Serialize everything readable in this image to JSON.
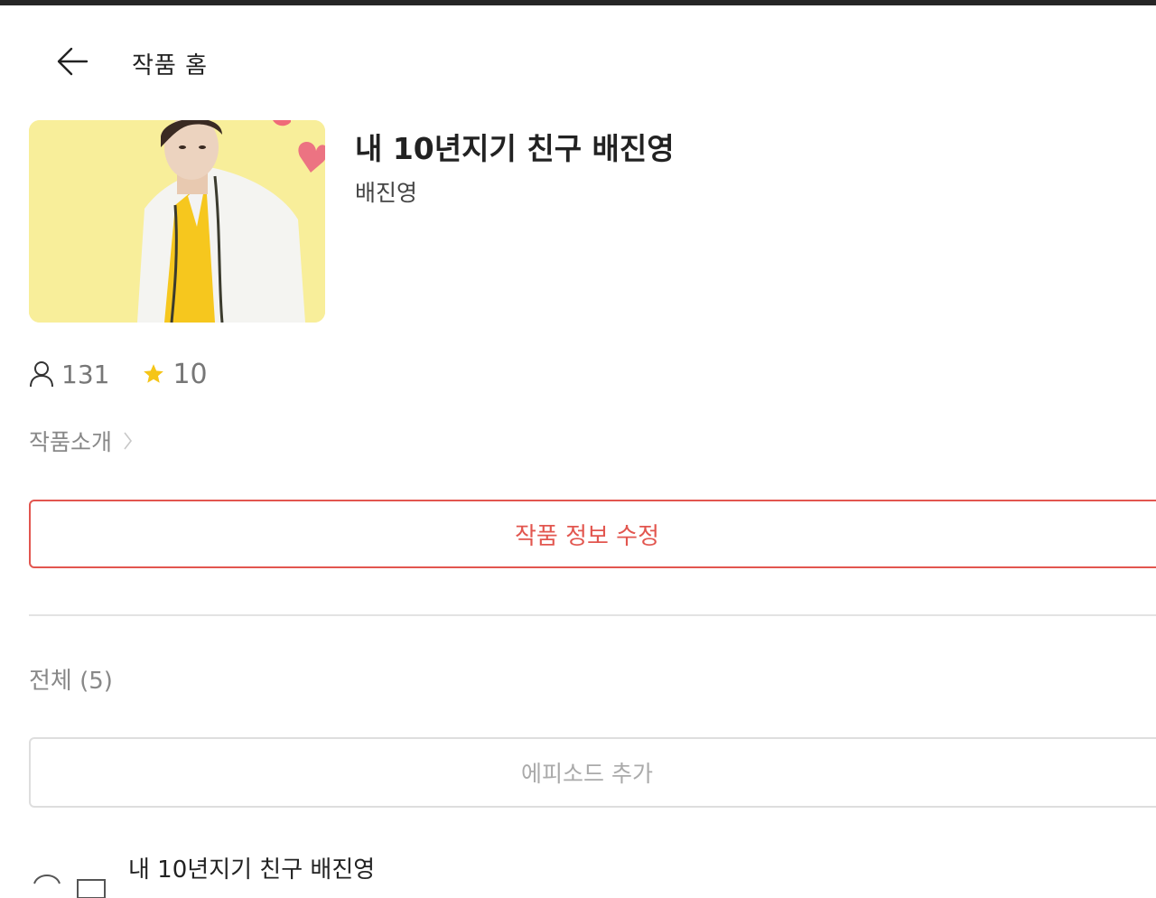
{
  "header": {
    "title": "작품 홈"
  },
  "work": {
    "title": "내 10년지기 친구 배진영",
    "author": "배진영"
  },
  "stats": {
    "readers": "131",
    "rating": "10"
  },
  "intro": {
    "label": "작품소개"
  },
  "actions": {
    "edit_label": "작품 정보 수정",
    "add_episode_label": "에피소드 추가"
  },
  "episodes": {
    "count_label": "전체 (5)",
    "items": [
      {
        "title": "내 10년지기 친구 배진영"
      }
    ]
  },
  "colors": {
    "accent": "#e2564f",
    "star": "#f5c518",
    "cover_background": "#f8ee9a"
  },
  "icons": {
    "back": "arrow-left-icon",
    "readers": "user-icon",
    "rating": "star-icon",
    "intro_more": "chevron-right-icon"
  }
}
